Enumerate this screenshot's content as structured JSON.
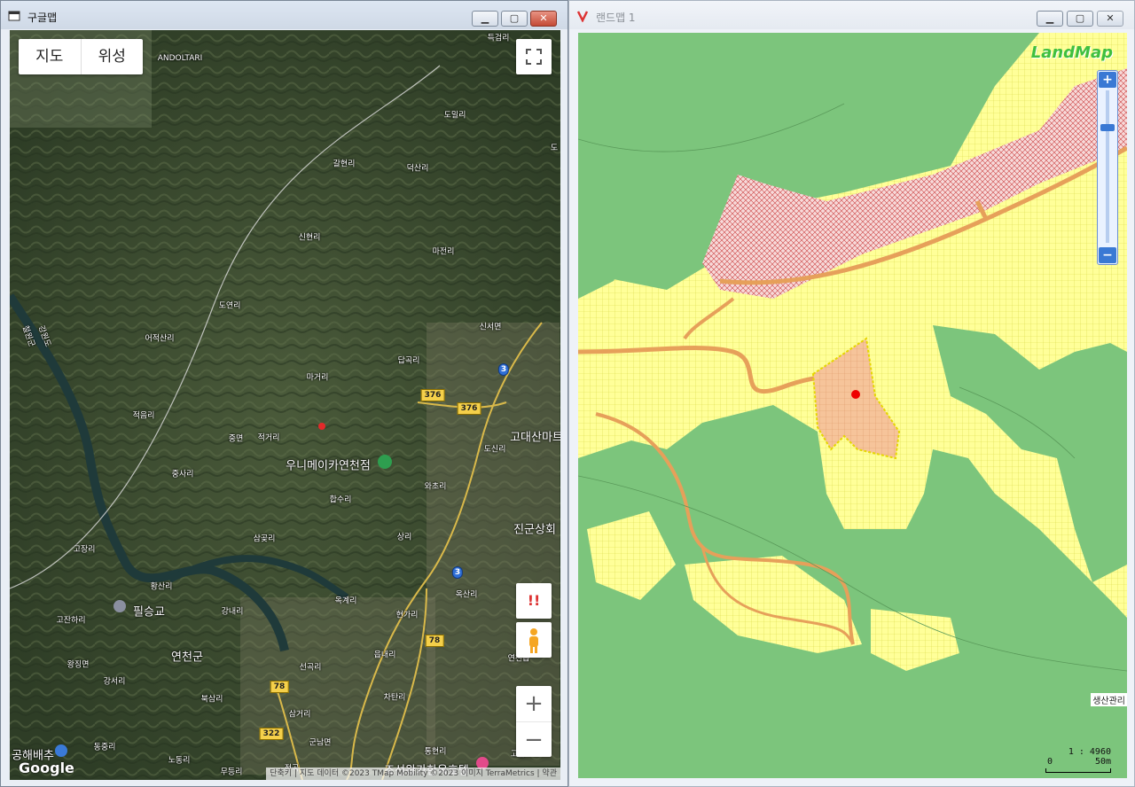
{
  "left_window": {
    "title": "구글맵",
    "buttons": {
      "minimize": "▁",
      "maximize": "▢",
      "close": "✕"
    },
    "map_type": {
      "map": "지도",
      "satellite": "위성"
    },
    "labels": [
      {
        "text": "득검리"
      },
      {
        "text": "ANDOLTARI"
      },
      {
        "text": "도밀리"
      },
      {
        "text": "갈현리"
      },
      {
        "text": "덕산리"
      },
      {
        "text": "신현리"
      },
      {
        "text": "마전리"
      },
      {
        "text": "도연리"
      },
      {
        "text": "신서면"
      },
      {
        "text": "어적산리"
      },
      {
        "text": "답곡리"
      },
      {
        "text": "마거리"
      },
      {
        "text": "적음리"
      },
      {
        "text": "중면"
      },
      {
        "text": "적거리"
      },
      {
        "text": "우니메이카연천점"
      },
      {
        "text": "도신리"
      },
      {
        "text": "고대산마트"
      },
      {
        "text": "중사리"
      },
      {
        "text": "와초리"
      },
      {
        "text": "합수리"
      },
      {
        "text": "진군상회"
      },
      {
        "text": "고장리"
      },
      {
        "text": "삼곶리"
      },
      {
        "text": "상리"
      },
      {
        "text": "황산리"
      },
      {
        "text": "필승교"
      },
      {
        "text": "고잔하리"
      },
      {
        "text": "강내리"
      },
      {
        "text": "옥계리"
      },
      {
        "text": "옥산리"
      },
      {
        "text": "현가리"
      },
      {
        "text": "연천군"
      },
      {
        "text": "왕징면"
      },
      {
        "text": "읍내리"
      },
      {
        "text": "연천읍"
      },
      {
        "text": "강서리"
      },
      {
        "text": "선곡리"
      },
      {
        "text": "북삼리"
      },
      {
        "text": "차탄리"
      },
      {
        "text": "삼거리"
      },
      {
        "text": "군남면"
      },
      {
        "text": "통현리"
      },
      {
        "text": "동중리"
      },
      {
        "text": "노동리"
      },
      {
        "text": "공해배추"
      },
      {
        "text": "무등리"
      },
      {
        "text": "고문"
      },
      {
        "text": "도"
      },
      {
        "text": "강원도"
      },
      {
        "text": "철원군"
      },
      {
        "text": "전곡"
      },
      {
        "text": "조선왕가한옥호텔"
      }
    ],
    "road_shields": [
      "376",
      "376",
      "3",
      "3",
      "78",
      "78",
      "322"
    ],
    "google_logo": "Google",
    "warning_symbol": "!!",
    "zoom_in": "+",
    "zoom_out": "−",
    "attribution": "단축키 | 지도 데이터 ©2023 TMap Mobility ©2023 이미지 TerraMetrics | 약관"
  },
  "right_window": {
    "title": "랜드맵 1",
    "buttons": {
      "minimize": "▁",
      "maximize": "▢",
      "close": "✕"
    },
    "logo": "LandMap",
    "zoom_in": "+",
    "zoom_out": "−",
    "scale_text": "1 : 4960",
    "scale_bar": {
      "start": "0",
      "end": "50m"
    },
    "edge_label": "생산관리"
  },
  "colors": {
    "landmap_green": "#7cc57c",
    "landmap_yellow": "#ffff99",
    "parcel": "#f6c49a",
    "road": "#e6a05a",
    "red_hatch": "#d55"
  }
}
